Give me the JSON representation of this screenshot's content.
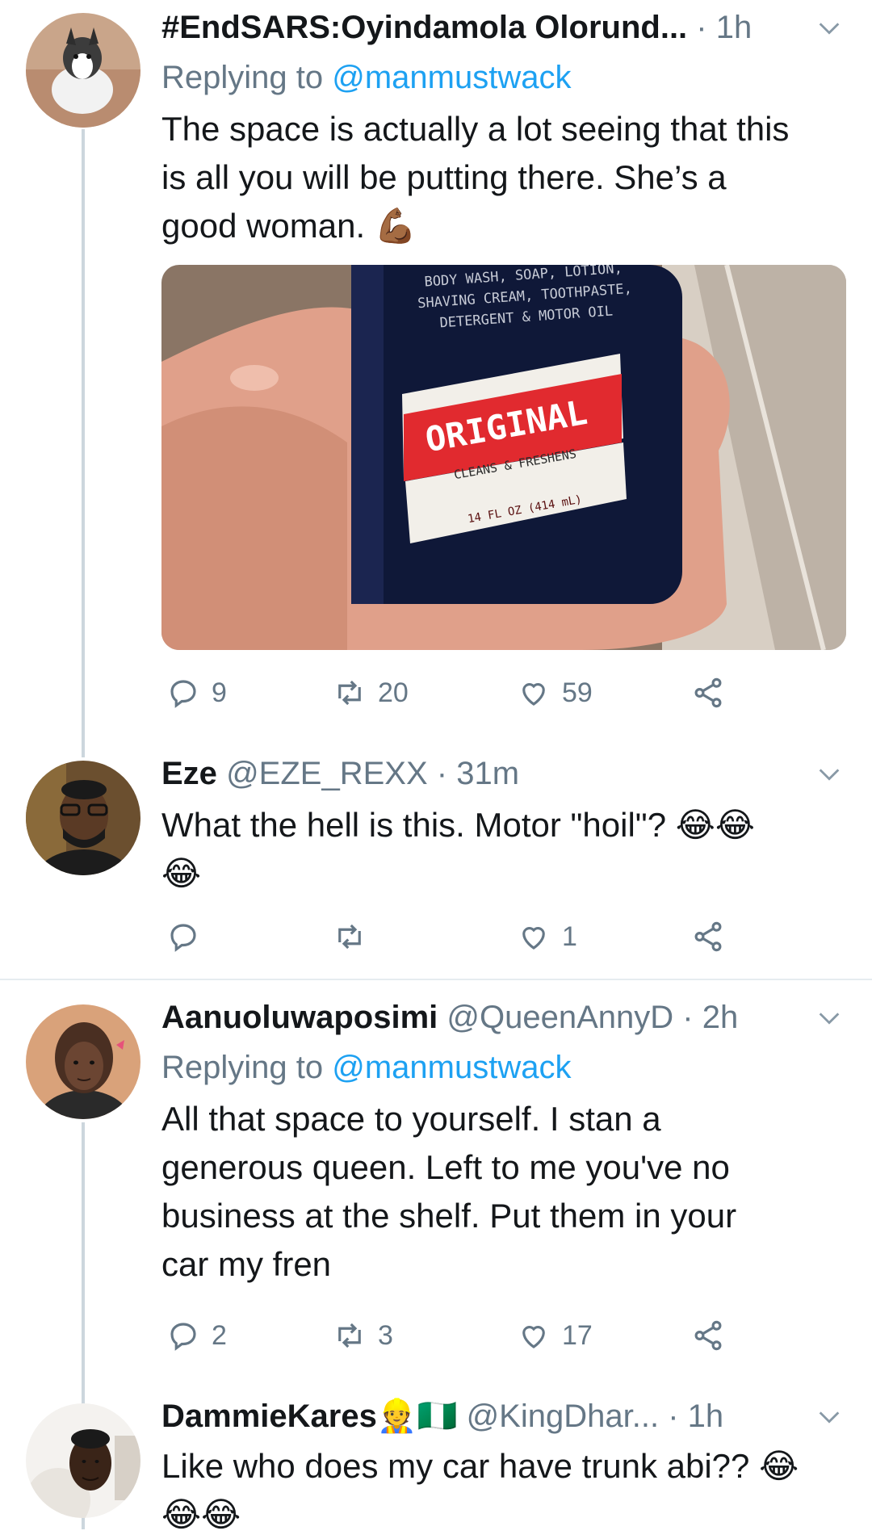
{
  "tweets": [
    {
      "name": "#EndSARS:Oyindamola Olorund...",
      "handle": "",
      "time": "1h",
      "replying_prefix": "Replying to ",
      "replying_to": "@manmustwack",
      "text_lines": [
        "The space is actually a lot seeing that this",
        "is all you will be putting there. She’s a",
        "good woman. 💪🏾"
      ],
      "media": {
        "label_top_lines": [
          "BODY WASH, SOAP, LOTION,",
          "SHAVING CREAM, TOOTHPASTE,",
          "DETERGENT & MOTOR OIL"
        ],
        "brand": "ORIGINAL",
        "tagline": "CLEANS & FRESHENS",
        "volume": "14 FL OZ (414 mL)"
      },
      "replies": "9",
      "retweets": "20",
      "likes": "59"
    },
    {
      "name": "Eze",
      "handle": "@EZE_REXX",
      "time": "31m",
      "text_lines": [
        "What the hell is this. Motor \"hoil\"? 😂😂",
        "😂"
      ],
      "replies": "",
      "retweets": "",
      "likes": "1"
    },
    {
      "name": "Aanuoluwaposimi",
      "handle": "@QueenAnnyD",
      "time": "2h",
      "replying_prefix": "Replying to ",
      "replying_to": "@manmustwack",
      "text_lines": [
        "All that space to yourself. I stan a",
        "generous queen. Left to me you've no",
        "business at the shelf. Put them in your",
        "car my fren"
      ],
      "replies": "2",
      "retweets": "3",
      "likes": "17"
    },
    {
      "name": "DammieKares",
      "name_emojis": "👷🇳🇬",
      "handle": "@KingDhar...",
      "time": "1h",
      "text_lines": [
        "Like who does my car have trunk abi?? 😂",
        "😂😂"
      ]
    }
  ],
  "separator": "·",
  "colors": {
    "text": "#14171a",
    "secondary": "#657786",
    "link": "#1da1f2",
    "divider": "#e6ecf0",
    "thread_line": "#ccd6dd"
  },
  "icons": [
    "reply-icon",
    "retweet-icon",
    "like-icon",
    "share-icon",
    "chevron-down-icon"
  ]
}
